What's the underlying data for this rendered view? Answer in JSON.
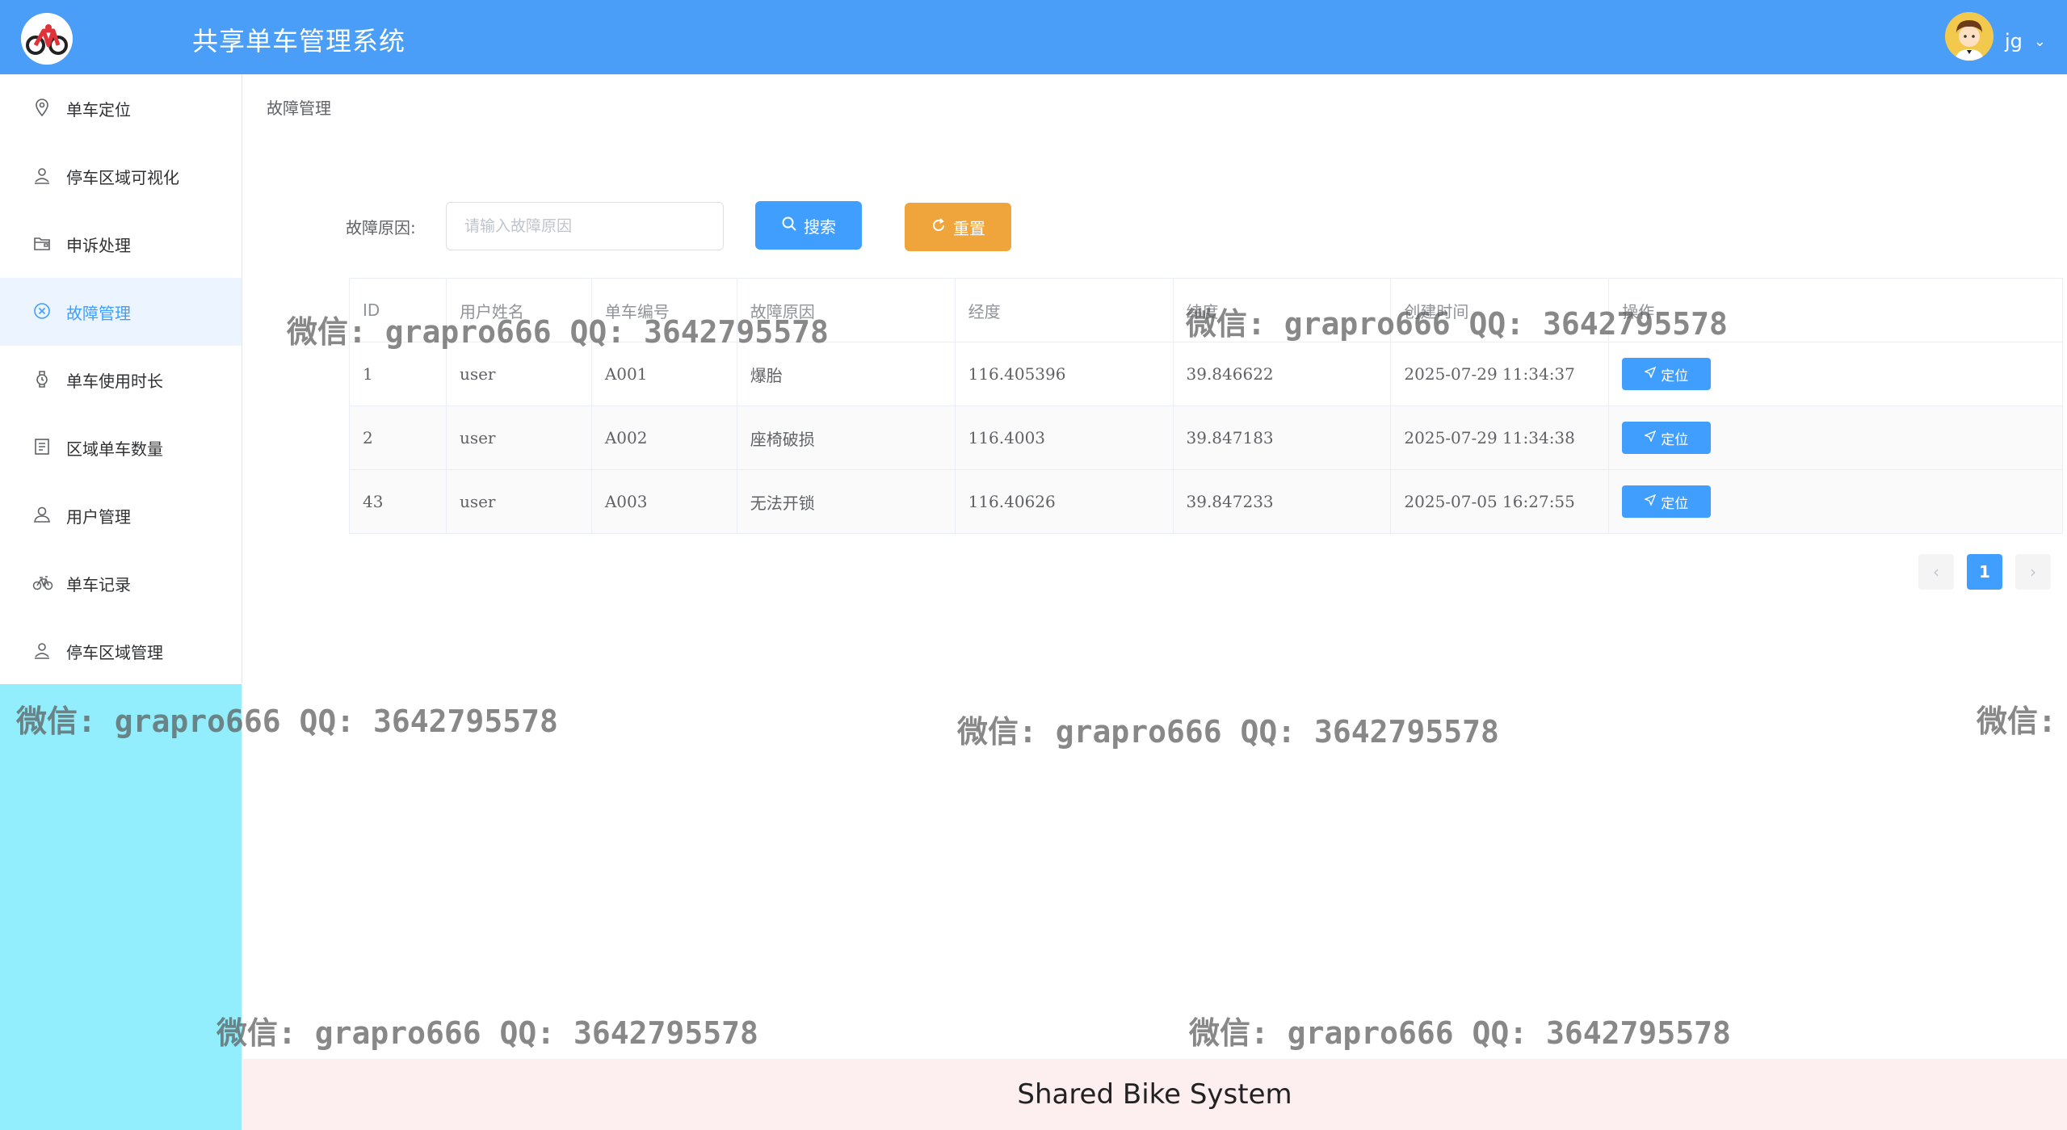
{
  "header": {
    "app_title": "共享单车管理系统",
    "username": "jg",
    "logo_icon": "bicycle-logo-icon",
    "avatar_icon": "user-avatar-icon",
    "background_color": "#4a9ef8"
  },
  "sidebar": {
    "items": [
      {
        "label": "单车定位",
        "icon": "location-pin-icon",
        "active": false
      },
      {
        "label": "停车区域可视化",
        "icon": "user-pin-icon",
        "active": false
      },
      {
        "label": "申诉处理",
        "icon": "folder-icon",
        "active": false
      },
      {
        "label": "故障管理",
        "icon": "circle-x-icon",
        "active": true
      },
      {
        "label": "单车使用时长",
        "icon": "watch-icon",
        "active": false
      },
      {
        "label": "区域单车数量",
        "icon": "document-icon",
        "active": false
      },
      {
        "label": "用户管理",
        "icon": "user-icon",
        "active": false
      },
      {
        "label": "单车记录",
        "icon": "bicycle-icon",
        "active": false
      },
      {
        "label": "停车区域管理",
        "icon": "user-pin-icon",
        "active": false
      }
    ],
    "active_color": "#409eff"
  },
  "breadcrumb": "故障管理",
  "search": {
    "label": "故障原因:",
    "placeholder": "请输入故障原因",
    "value": "",
    "search_button": "搜索",
    "reset_button": "重置"
  },
  "table": {
    "columns": [
      "ID",
      "用户姓名",
      "单车编号",
      "故障原因",
      "经度",
      "纬度",
      "创建时间",
      "操作"
    ],
    "rows": [
      {
        "id": "1",
        "user": "user",
        "bike": "A001",
        "reason": "爆胎",
        "lng": "116.405396",
        "lat": "39.846622",
        "time": "2025-07-29 11:34:37",
        "action": "定位"
      },
      {
        "id": "2",
        "user": "user",
        "bike": "A002",
        "reason": "座椅破损",
        "lng": "116.4003",
        "lat": "39.847183",
        "time": "2025-07-29 11:34:38",
        "action": "定位"
      },
      {
        "id": "43",
        "user": "user",
        "bike": "A003",
        "reason": "无法开锁",
        "lng": "116.40626",
        "lat": "39.847233",
        "time": "2025-07-05 16:27:55",
        "action": "定位"
      }
    ]
  },
  "pagination": {
    "prev": "‹",
    "current_page": "1",
    "next": "›"
  },
  "watermark": "微信: grapro666 QQ: 3642795578",
  "watermark_partial": "微信:",
  "footer": "Shared Bike System"
}
